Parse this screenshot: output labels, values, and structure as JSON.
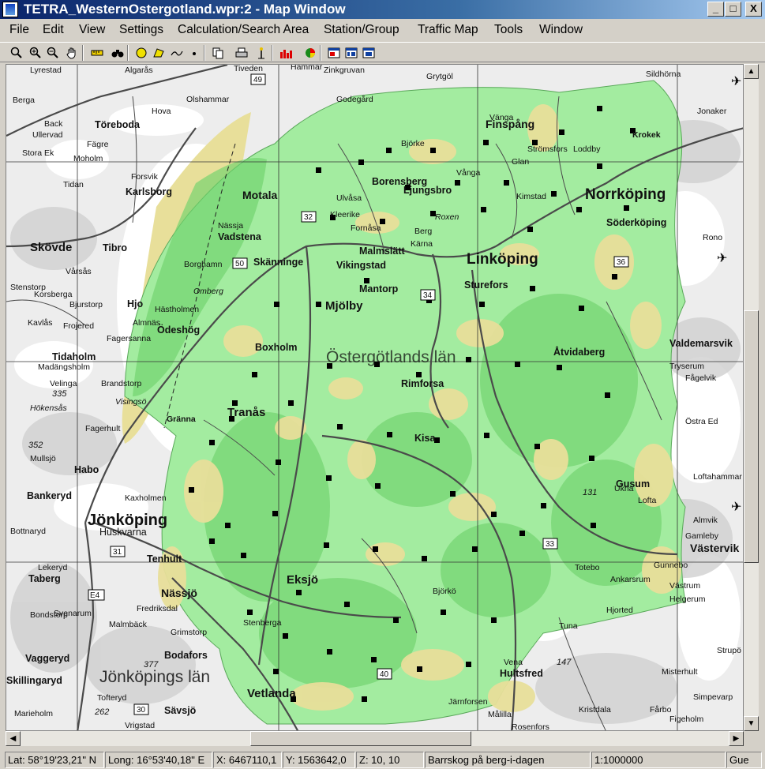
{
  "window": {
    "title": "TETRA_WesternOstergotland.wpr:2 - Map Window",
    "buttons": {
      "minimize": "_",
      "maximize": "□",
      "close": "X"
    }
  },
  "menu": [
    "File",
    "Edit",
    "View",
    "Settings",
    "Calculation/Search Area",
    "Station/Group",
    "Traffic Map",
    "Tools",
    "Window"
  ],
  "toolbar_icons": [
    "zoom-tool-icon",
    "zoom-in-icon",
    "zoom-out-icon",
    "pan-hand-icon",
    "ruler-icon",
    "binoculars-icon",
    "circle-icon",
    "polygon-icon",
    "line-icon",
    "point-icon",
    "copy-icon",
    "print-icon",
    "station-icon",
    "histogram-icon",
    "pie-icon",
    "window-1-icon",
    "window-2-icon",
    "window-3-icon"
  ],
  "map": {
    "colors": {
      "coverage": "#9de69a",
      "coverage_dark": "#5bc95a",
      "forest_yellow": "#e8df9a",
      "lake": "#ffffff",
      "road": "#555555",
      "background": "#ececec"
    },
    "big_labels": [
      "Norrköping",
      "Linköping",
      "Jönköping",
      "Östergötlands län",
      "Jönköpings län"
    ],
    "city_labels": [
      "Motala",
      "Vadstena",
      "Skänninge",
      "Mjölby",
      "Tranås",
      "Eksjö",
      "Nässjö",
      "Vetlanda",
      "Hultsfred",
      "Söderköping",
      "Finspång",
      "Valdemarsvik",
      "Västervik",
      "Karlsborg",
      "Skövde",
      "Tibro",
      "Hjo",
      "Tidaholm",
      "Habo",
      "Bankeryd",
      "Taberg",
      "Vaggeryd",
      "Skillingaryd",
      "Sävsjö",
      "Boxholm",
      "Ödeshög",
      "Rimforsa",
      "Kisa",
      "Malmslätt",
      "Ljungsbro",
      "Borensberg",
      "Töreboda",
      "Vikingstad",
      "Mantorp",
      "Sturefors",
      "Åtvidaberg",
      "Gusum",
      "Tenhult",
      "Huskvarna",
      "Bodafors"
    ],
    "small_labels": [
      "Lyrestad",
      "Algarås",
      "Tiveden",
      "Hammar",
      "Zinkgruvan",
      "Grytgöl",
      "Sildhörna",
      "Berga",
      "Olshammar",
      "Godegård",
      "Vånga",
      "Björke",
      "Strömsfors",
      "Glan",
      "Loddby",
      "Kimstad",
      "Krokek",
      "Jonaker",
      "Back",
      "Ullervad",
      "Fägre",
      "Stora Ek",
      "Moholm",
      "Forsvik",
      "Tidan",
      "Hova",
      "Rono",
      "Vänga",
      "Roxen",
      "Berg",
      "Kärna",
      "Kleerike",
      "Fornåsa",
      "Ulvåsa",
      "Nässja",
      "Borghamn",
      "Omberg",
      "Hästholmen",
      "Almnäs",
      "Fagersanna",
      "Vårsås",
      "Bjurstorp",
      "Korsberga",
      "Stenstorp",
      "Kavlås",
      "Frojered",
      "Hökensås",
      "Madängsholm",
      "Velinga",
      "Brandstorp",
      "Fagerhult",
      "Gränna",
      "Visingsö",
      "Kaxholmen",
      "Lekeryd",
      "Bottnaryd",
      "Mullsjö",
      "Svenarum",
      "Bondstorp",
      "Malmbäck",
      "Fredriksdal",
      "Grimstorp",
      "Tofteryd",
      "Marieholm",
      "Vrigstad",
      "Bodafors",
      "Stenberga",
      "Björkö",
      "Tuna",
      "Vena",
      "Järnforsen",
      "Målilla",
      "Rosenfors",
      "Kristdala",
      "Fårbo",
      "Figeholm",
      "Simpevarp",
      "Misterhult",
      "Strupö",
      "Loftahammar",
      "Tryserum",
      "Fågelvik",
      "Östra Ed",
      "Gunnebo",
      "Helgerum",
      "Hjorted",
      "Ankarsrum",
      "Västrum",
      "Totebo",
      "Ukna",
      "Lofta",
      "Almvik",
      "Gamleby"
    ],
    "route_shields": [
      "49",
      "50",
      "32",
      "34",
      "36",
      "31",
      "E4",
      "30",
      "40",
      "33"
    ],
    "route_numbers": [
      "335",
      "352",
      "377",
      "262",
      "147",
      "131"
    ]
  },
  "scrollbar": {
    "up": "▲",
    "down": "▼",
    "left": "◀",
    "right": "▶"
  },
  "status": {
    "lat": "Lat: 58°19'23,21\" N",
    "long": "Long: 16°53'40,18\" E",
    "x": "X: 6467110,1",
    "y": "Y: 1563642,0",
    "z": "Z: 10, 10",
    "terrain": "Barrskog på berg-i-dagen",
    "scale": "1:1000000",
    "user": "Gue"
  }
}
